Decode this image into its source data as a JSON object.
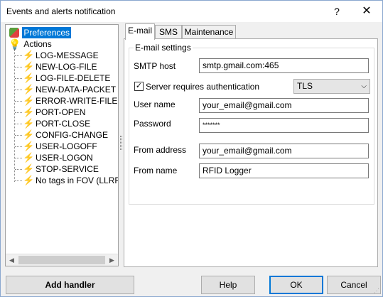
{
  "window": {
    "title": "Events and alerts notification",
    "help_glyph": "?",
    "close_glyph": "✕"
  },
  "tree": {
    "root": {
      "label": "Preferences",
      "icon": "preferences-icon"
    },
    "actions": {
      "label": "Actions",
      "icon": "lightbulb-icon",
      "expander": "−"
    },
    "items": [
      {
        "label": "LOG-MESSAGE",
        "icon": "lightning-icon"
      },
      {
        "label": "NEW-LOG-FILE",
        "icon": "lightning-icon"
      },
      {
        "label": "LOG-FILE-DELETE",
        "icon": "lightning-icon"
      },
      {
        "label": "NEW-DATA-PACKET",
        "icon": "lightning-icon"
      },
      {
        "label": "ERROR-WRITE-FILE",
        "icon": "lightning-icon"
      },
      {
        "label": "PORT-OPEN",
        "icon": "lightning-icon"
      },
      {
        "label": "PORT-CLOSE",
        "icon": "lightning-icon"
      },
      {
        "label": "CONFIG-CHANGE",
        "icon": "lightning-icon"
      },
      {
        "label": "USER-LOGOFF",
        "icon": "lightning-icon"
      },
      {
        "label": "USER-LOGON",
        "icon": "lightning-icon"
      },
      {
        "label": "STOP-SERVICE",
        "icon": "lightning-icon"
      },
      {
        "label": "No tags in FOV (LLRP_",
        "icon": "lightning-icon"
      }
    ],
    "scroll_left": "◀",
    "scroll_right": "▶"
  },
  "tabs": [
    {
      "label": "E-mail",
      "active": true
    },
    {
      "label": "SMS",
      "active": false
    },
    {
      "label": "Maintenance",
      "active": false
    }
  ],
  "email": {
    "group_title": "E-mail settings",
    "smtp_host_label": "SMTP host",
    "smtp_host_value": "smtp.gmail.com:465",
    "auth_label": "Server requires authentication",
    "auth_checked": true,
    "auth_check_glyph": "✓",
    "security_value": "TLS",
    "security_arrow": "⌵",
    "username_label": "User name",
    "username_value": "your_email@gmail.com",
    "password_label": "Password",
    "password_value": "*******",
    "from_address_label": "From address",
    "from_address_value": "your_email@gmail.com",
    "from_name_label": "From name",
    "from_name_value": "RFID Logger"
  },
  "buttons": {
    "add_handler": "Add handler",
    "help": "Help",
    "ok": "OK",
    "cancel": "Cancel"
  }
}
